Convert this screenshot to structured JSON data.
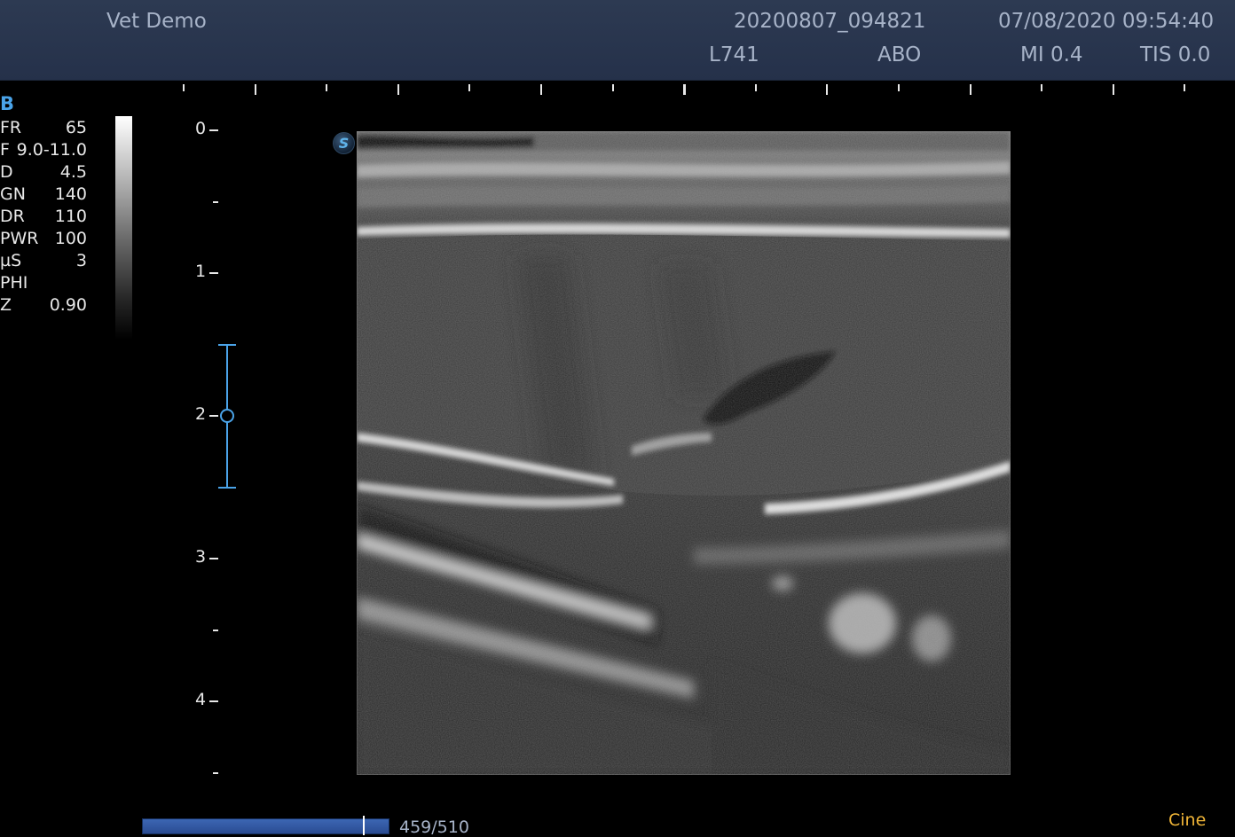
{
  "header": {
    "patient_name": "Vet Demo",
    "study_id": "20200807_094821",
    "datetime": "07/08/2020 09:54:40",
    "probe": "L741",
    "preset": "ABO",
    "mi": "MI 0.4",
    "tis": "TIS 0.0"
  },
  "imaging": {
    "mode": "B",
    "params": [
      {
        "label": "FR",
        "value": "65"
      },
      {
        "label": "F",
        "value": "9.0-11.0"
      },
      {
        "label": "D",
        "value": "4.5"
      },
      {
        "label": "GN",
        "value": "140"
      },
      {
        "label": "DR",
        "value": "110"
      },
      {
        "label": "PWR",
        "value": "100"
      },
      {
        "label": "µS",
        "value": "3"
      },
      {
        "label": "PHI",
        "value": ""
      },
      {
        "label": "Z",
        "value": "0.90"
      }
    ]
  },
  "depth_scale": {
    "unit_labels": [
      "0",
      "1",
      "2",
      "3",
      "4"
    ],
    "focus_depth": 2.0,
    "focus_range": [
      1.5,
      2.5
    ],
    "max_depth": 4.5
  },
  "badge": {
    "label": "S"
  },
  "cine": {
    "label": "Cine",
    "frame_text": "459/510",
    "current_frame": 459,
    "total_frames": 510
  },
  "colors": {
    "header_text": "#a7b3c8",
    "accent_blue": "#4aa3e8",
    "cine_yellow": "#f0b537"
  }
}
